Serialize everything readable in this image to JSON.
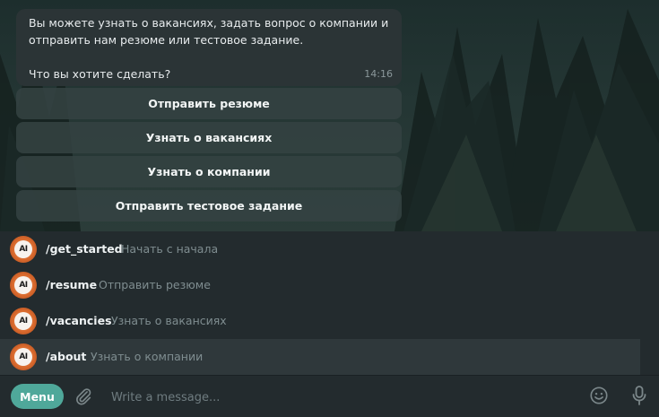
{
  "message": {
    "line1": "Вы можете узнать о вакансиях, задать вопрос о компании и",
    "line2": "отправить нам резюме или тестовое задание.",
    "line3": "Что вы хотите сделать?",
    "time": "14:16"
  },
  "keyboard": [
    {
      "label": "Отправить резюме"
    },
    {
      "label": "Узнать о вакансиях"
    },
    {
      "label": "Узнать о компании"
    },
    {
      "label": "Отправить тестовое задание"
    }
  ],
  "commands": [
    {
      "name": "/get_started",
      "desc": "Начать с начала",
      "avatar": "AI"
    },
    {
      "name": "/resume",
      "desc": "Отправить резюме",
      "avatar": "AI"
    },
    {
      "name": "/vacancies",
      "desc": "Узнать о вакансиях",
      "avatar": "AI"
    },
    {
      "name": "/about",
      "desc": "Узнать о компании",
      "avatar": "AI"
    }
  ],
  "composer": {
    "menu_label": "Menu",
    "placeholder": "Write a message..."
  },
  "colors": {
    "accent": "#4fa89a",
    "avatar": "#d96a2e"
  },
  "icons": {
    "attach": "paperclip-icon",
    "emoji": "emoji-icon",
    "mic": "microphone-icon"
  }
}
